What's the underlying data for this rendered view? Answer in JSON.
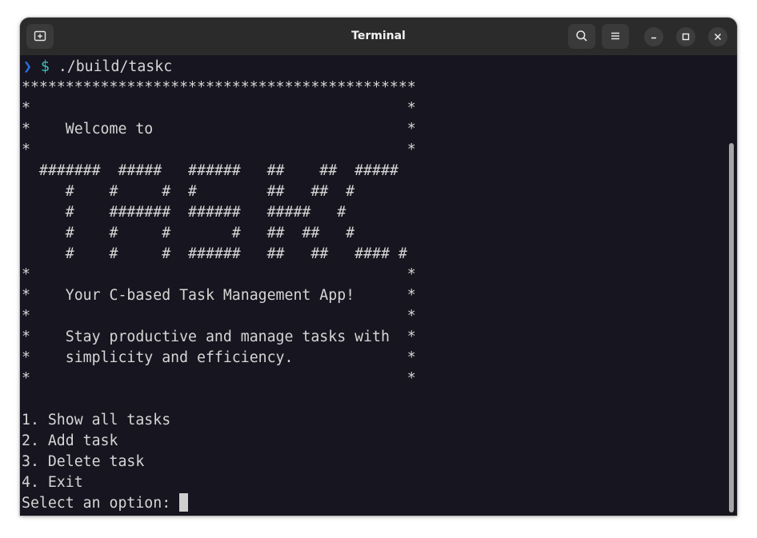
{
  "window": {
    "title": "Terminal"
  },
  "prompt": {
    "arrow": "❯",
    "symbol": "$",
    "command": "./build/taskc"
  },
  "output_lines": [
    "*********************************************",
    "*                                           *",
    "*    Welcome to                             *",
    "*                                           *",
    "  #######  #####   ######   ##    ##  #####",
    "     #    #     #  #        ##   ##  #",
    "     #    #######  ######   #####   #",
    "     #    #     #       #   ##  ##   #",
    "     #    #     #  ######   ##   ##   #### #",
    "*                                           *",
    "*    Your C-based Task Management App!      *",
    "*                                           *",
    "*    Stay productive and manage tasks with  *",
    "*    simplicity and efficiency.             *",
    "*                                           *",
    "",
    "1. Show all tasks",
    "2. Add task",
    "3. Delete task",
    "4. Exit"
  ],
  "input_prompt": "Select an option: ",
  "icons": {
    "new_tab": "new-tab-icon",
    "search": "search-icon",
    "menu": "hamburger-menu-icon",
    "minimize": "minimize-icon",
    "maximize": "maximize-icon",
    "close": "close-icon"
  },
  "colors": {
    "terminal_background": "#17151f",
    "titlebar_background": "#2b2b2b",
    "text": "#d6d6d6",
    "prompt_arrow": "#2a6fe0",
    "prompt_dollar": "#3cc0c0"
  }
}
